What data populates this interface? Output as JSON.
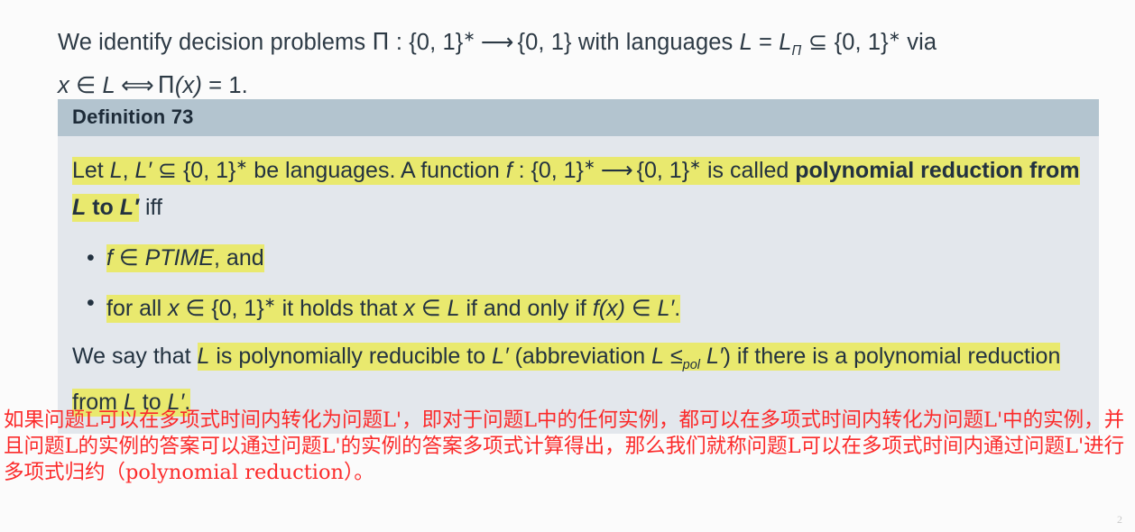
{
  "slide": {
    "background_color": "#fbfbfb",
    "page_number": "2"
  },
  "intro": {
    "line1_a": "We identify decision problems ",
    "line1_pi": "Π",
    "line1_b": " : {0, 1}",
    "line1_star": "∗",
    "line1_arrow": " ⟶ ",
    "line1_c": "{0, 1} with languages ",
    "line1_L": "L",
    "line1_eq": " = ",
    "line1_Lpi": "L",
    "line1_Lpi_sub": "Π",
    "line1_subset": " ⊆ ",
    "line1_d": "{0, 1}",
    "line1_star2": "∗",
    "line1_e": " via",
    "line2_x": "x",
    "line2_in": " ∈ ",
    "line2_L": "L",
    "line2_iff": "  ⟺  ",
    "line2_pi": "Π",
    "line2_xparen": "(x)",
    "line2_eq1": " = 1."
  },
  "definition": {
    "title": "Definition 73",
    "header_bg": "#b3c4cf",
    "body_bg": "#e3e7ec",
    "highlight_color": "#e9e96e",
    "para1": {
      "t1": "Let ",
      "L": "L",
      "comma": ", ",
      "Lp": "L′",
      "subset": " ⊆ ",
      "set": "{0, 1}",
      "star": "∗",
      "t2": " be languages. A function ",
      "f": "f",
      "colon": " : ",
      "set2": "{0, 1}",
      "star2": "∗",
      "arrow": " ⟶ ",
      "set3": "{0, 1}",
      "star3": "∗",
      "t3": " is called ",
      "bold1": "polynomial reduction from ",
      "boldL": "L",
      "boldto": " to ",
      "boldLp": "L′",
      "t4": " iff"
    },
    "bullets": [
      {
        "marker": "•",
        "f": "f",
        "in": " ∈ ",
        "ptime": "PTIME",
        "tail": ", and",
        "highlighted": true
      },
      {
        "marker": "•",
        "t1": "for all ",
        "x": "x",
        "in": " ∈ ",
        "set": "{0, 1}",
        "star": "∗",
        "t2": " it holds that ",
        "x2": "x",
        "in2": " ∈ ",
        "L": "L",
        "t3": " if and only if ",
        "fx": "f(x)",
        "in3": " ∈ ",
        "Lp": "L′",
        "dot": ".",
        "highlighted": true
      }
    ],
    "para2": {
      "lead": "We say that ",
      "L": "L",
      "t1": " is polynomially reducible to ",
      "Lp": "L′",
      "t2": " (abbreviation ",
      "L2": "L",
      "le": " ≤",
      "pol": "pol",
      "Lp2": " L′",
      "t3": ") if there is a polynomial reduction from ",
      "L3": "L",
      "to": " to ",
      "Lp3": "L′",
      "dot": "."
    }
  },
  "annotation": {
    "color": "#fb2b2b",
    "text": "如果问题L可以在多项式时间内转化为问题L'，即对于问题L中的任何实例，都可以在多项式时间内转化为问题L'中的实例，并且问题L的实例的答案可以通过问题L'的实例的答案多项式计算得出，那么我们就称问题L可以在多项式时间内通过问题L'进行多项式归约（polynomial reduction）。"
  }
}
